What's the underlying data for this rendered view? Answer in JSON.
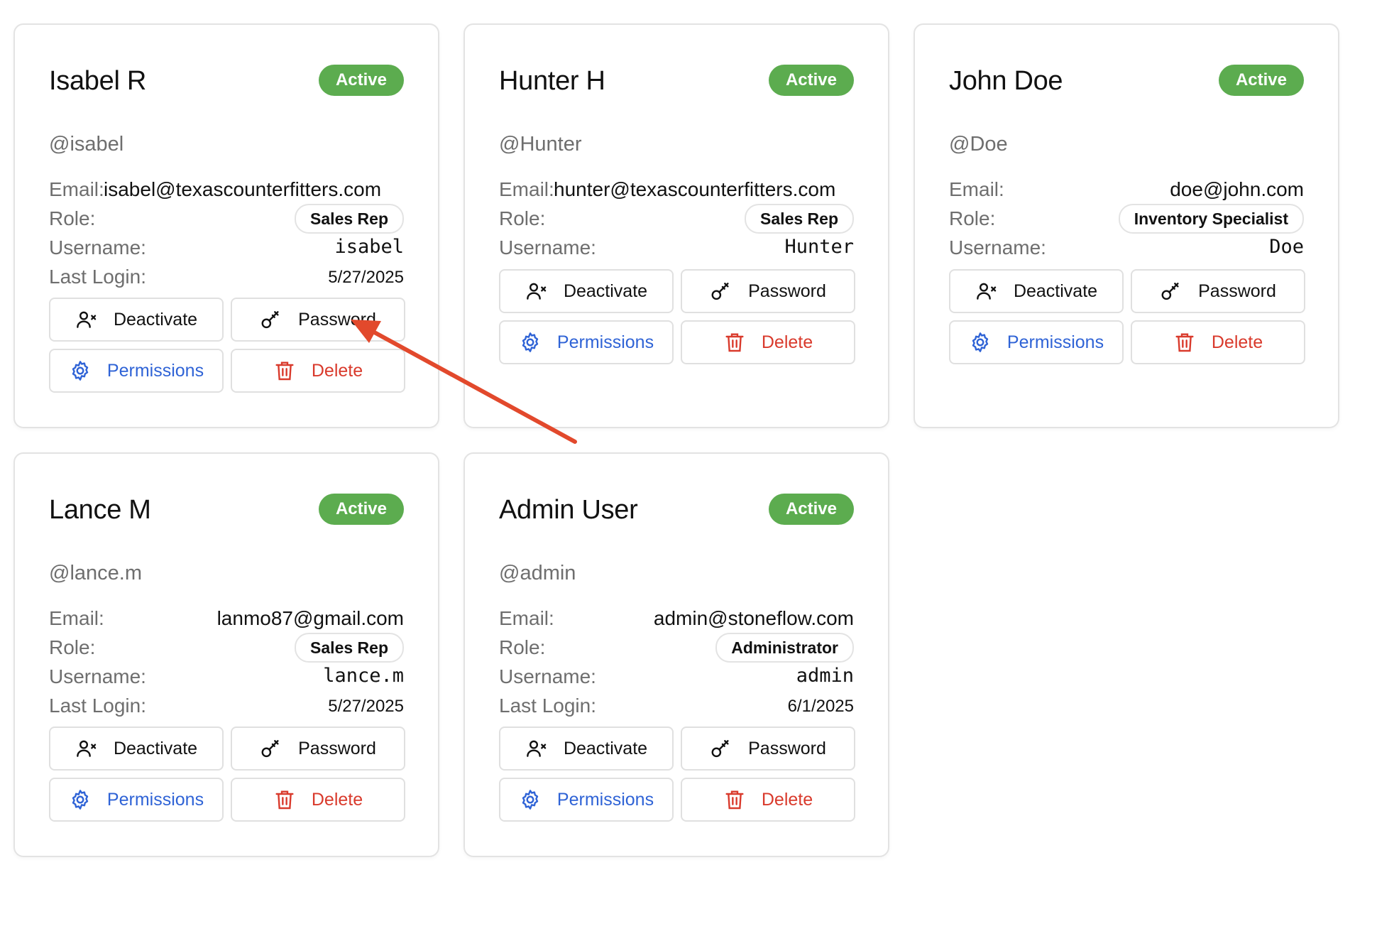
{
  "labels": {
    "email": "Email:",
    "role": "Role:",
    "username": "Username:",
    "last_login": "Last Login:"
  },
  "buttons": {
    "deactivate": "Deactivate",
    "password": "Password",
    "permissions": "Permissions",
    "delete": "Delete"
  },
  "colors": {
    "active_badge": "#5cac4f",
    "permissions_text": "#2f63d6",
    "delete_text": "#d93a2c",
    "annotation_arrow": "#e2492c"
  },
  "users": [
    {
      "name": "Isabel R",
      "status": "Active",
      "handle": "@isabel",
      "email": "isabel@texascounterfitters.com",
      "role": "Sales Rep",
      "username": "isabel",
      "last_login": "5/27/2025"
    },
    {
      "name": "Hunter H",
      "status": "Active",
      "handle": "@Hunter",
      "email": "hunter@texascounterfitters.com",
      "role": "Sales Rep",
      "username": "Hunter"
    },
    {
      "name": "John Doe",
      "status": "Active",
      "handle": "@Doe",
      "email": "doe@john.com",
      "role": "Inventory Specialist",
      "username": "Doe"
    },
    {
      "name": "Lance M",
      "status": "Active",
      "handle": "@lance.m",
      "email": "lanmo87@gmail.com",
      "role": "Sales Rep",
      "username": "lance.m",
      "last_login": "5/27/2025"
    },
    {
      "name": "Admin User",
      "status": "Active",
      "handle": "@admin",
      "email": "admin@stoneflow.com",
      "role": "Administrator",
      "username": "admin",
      "last_login": "6/1/2025"
    }
  ]
}
